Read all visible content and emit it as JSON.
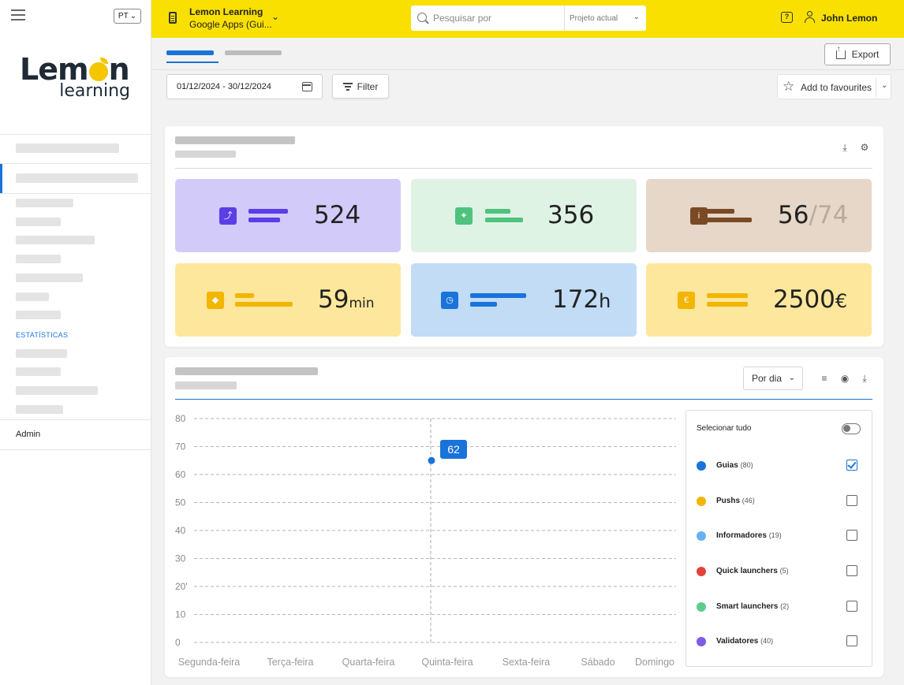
{
  "sidebar": {
    "language": "PT",
    "logo_top": "Lemon",
    "logo_bottom": "learning",
    "section_label": "ESTATÍSTICAS",
    "admin_label": "Admin"
  },
  "topbar": {
    "project_title": "Lemon Learning",
    "project_subtitle": "Google Apps (Gui...",
    "search_placeholder": "Pesquisar por",
    "search_scope": "Projeto actual",
    "user_name": "John Lemon",
    "help_glyph": "?"
  },
  "toolbar": {
    "export_label": "Export",
    "date_range": "01/12/2024 - 30/12/2024",
    "filter_label": "Filter",
    "favourites_label": "Add to favourites"
  },
  "stats": [
    {
      "value": "524",
      "unit": "",
      "secondary": "",
      "color": "#d2cbfa",
      "icon_color": "#5b3ee6",
      "icon": "user-add-icon",
      "glyph": "⤴"
    },
    {
      "value": "356",
      "unit": "",
      "secondary": "",
      "color": "#dff3e5",
      "icon_color": "#4fc27d",
      "icon": "cursor-click-icon",
      "glyph": "✦"
    },
    {
      "value": "56",
      "unit": "",
      "secondary": "/74",
      "color": "#e6d7c8",
      "icon_color": "#7a4a25",
      "icon": "info-box-icon",
      "glyph": "i"
    },
    {
      "value": "59",
      "unit": "min",
      "secondary": "",
      "color": "#fde79c",
      "icon_color": "#f2b500",
      "icon": "graduation-cap-icon",
      "glyph": "◆"
    },
    {
      "value": "172",
      "unit": "h",
      "secondary": "",
      "color": "#c2dcf6",
      "icon_color": "#1a73d9",
      "icon": "clock-icon",
      "glyph": "◷"
    },
    {
      "value": "2500",
      "unit": "€",
      "secondary": "",
      "color": "#fde79c",
      "icon_color": "#f2b500",
      "icon": "euro-coin-icon",
      "glyph": "€"
    }
  ],
  "chart_controls": {
    "period_label": "Por dia"
  },
  "chart_data": {
    "type": "line",
    "categories": [
      "Segunda-feira",
      "Terça-feira",
      "Quarta-feira",
      "Quinta-feira",
      "Sexta-feira",
      "Sábado",
      "Domingo"
    ],
    "y_ticks": [
      "0",
      "10",
      "20'",
      "30",
      "40",
      "50",
      "60",
      "70",
      "80"
    ],
    "ylim": [
      0,
      80
    ],
    "grid": true,
    "series": [
      {
        "name": "Guias",
        "color": "#1a73d9",
        "points": [
          {
            "x": "Quinta-feira",
            "y": 65
          }
        ]
      }
    ],
    "tooltip": {
      "label": "62",
      "x": "Quinta-feira"
    },
    "legend_position": "right"
  },
  "legend": {
    "select_all_label": "Selecionar tudo",
    "items": [
      {
        "name": "Guias",
        "count": "(80)",
        "color": "#1a73d9",
        "checked": true
      },
      {
        "name": "Pushs",
        "count": "(46)",
        "color": "#f2b500",
        "checked": false
      },
      {
        "name": "Informadores",
        "count": "(19)",
        "color": "#67b2f0",
        "checked": false
      },
      {
        "name": "Quick launchers",
        "count": "(5)",
        "color": "#e5403a",
        "checked": false
      },
      {
        "name": "Smart launchers",
        "count": "(2)",
        "color": "#5fcc8b",
        "checked": false
      },
      {
        "name": "Validatores",
        "count": "(40)",
        "color": "#7c5ce8",
        "checked": false
      }
    ]
  }
}
